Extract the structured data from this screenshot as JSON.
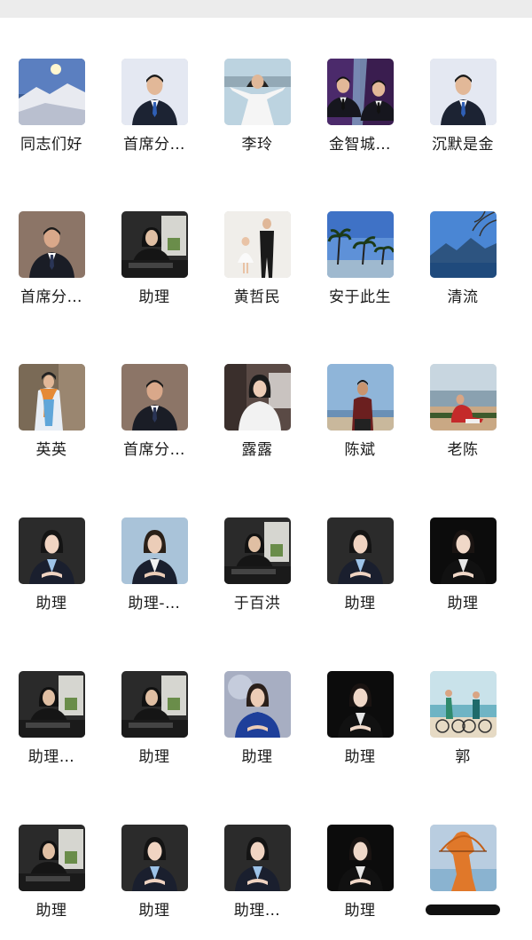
{
  "contacts": [
    {
      "name": "同志们好",
      "icon": "snow-mountain-avatar"
    },
    {
      "name": "首席分…",
      "icon": "man-suit-avatar"
    },
    {
      "name": "李玲",
      "icon": "woman-white-dress-avatar"
    },
    {
      "name": "金智城…",
      "icon": "two-men-avatar"
    },
    {
      "name": "沉默是金",
      "icon": "man-suit-avatar"
    },
    {
      "name": "首席分…",
      "icon": "man-suit-brown-avatar"
    },
    {
      "name": "助理",
      "icon": "woman-desk-avatar"
    },
    {
      "name": "黄哲民",
      "icon": "father-daughter-avatar"
    },
    {
      "name": "安于此生",
      "icon": "palm-beach-avatar"
    },
    {
      "name": "清流",
      "icon": "lake-mountain-avatar"
    },
    {
      "name": "英英",
      "icon": "woman-scarf-avatar"
    },
    {
      "name": "首席分…",
      "icon": "man-suit-brown-avatar"
    },
    {
      "name": "露露",
      "icon": "woman-office-avatar"
    },
    {
      "name": "陈斌",
      "icon": "man-seaside-avatar"
    },
    {
      "name": "老陈",
      "icon": "man-beach-avatar"
    },
    {
      "name": "助理",
      "icon": "woman-suit-dark-avatar"
    },
    {
      "name": "助理-…",
      "icon": "woman-suit-light-avatar"
    },
    {
      "name": "于百洪",
      "icon": "woman-desk-avatar"
    },
    {
      "name": "助理",
      "icon": "woman-suit-dark-avatar"
    },
    {
      "name": "助理",
      "icon": "woman-suit-black-avatar"
    },
    {
      "name": "助理…",
      "icon": "woman-desk-avatar"
    },
    {
      "name": "助理",
      "icon": "woman-desk-avatar"
    },
    {
      "name": "助理",
      "icon": "woman-suit-blue-avatar"
    },
    {
      "name": "助理",
      "icon": "woman-suit-black-avatar"
    },
    {
      "name": "郭",
      "icon": "couple-bikes-avatar"
    },
    {
      "name": "助理",
      "icon": "woman-desk-avatar"
    },
    {
      "name": "助理",
      "icon": "woman-suit-dark-avatar"
    },
    {
      "name": "助理…",
      "icon": "woman-suit-dark-avatar"
    },
    {
      "name": "助理",
      "icon": "woman-suit-black-avatar"
    },
    {
      "name": "",
      "icon": "archer-statue-avatar"
    }
  ],
  "colors": {
    "background": "#ffffff",
    "topbar": "#ececec",
    "text": "#1a1a1a"
  }
}
